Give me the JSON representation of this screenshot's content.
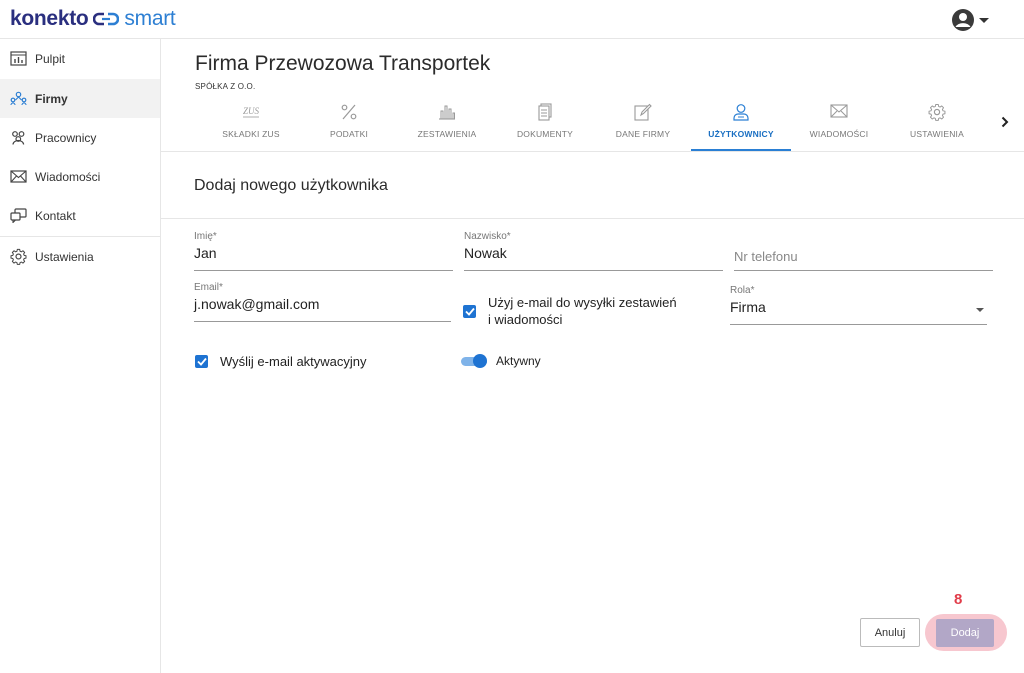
{
  "app": {
    "logo_left": "konekto",
    "logo_right": "smart"
  },
  "sidebar": {
    "items": [
      {
        "label": "Pulpit",
        "icon": "dashboard-icon"
      },
      {
        "label": "Firmy",
        "icon": "companies-icon"
      },
      {
        "label": "Pracownicy",
        "icon": "employees-icon"
      },
      {
        "label": "Wiadomości",
        "icon": "envelope-icon"
      },
      {
        "label": "Kontakt",
        "icon": "contact-icon"
      },
      {
        "label": "Ustawienia",
        "icon": "gear-icon"
      }
    ],
    "active": "Firmy"
  },
  "header": {
    "company_name": "Firma Przewozowa Transportek",
    "company_type": "SPÓŁKA Z O.O."
  },
  "tabs": [
    {
      "label": "SKŁADKI ZUS",
      "icon": "zus-icon"
    },
    {
      "label": "PODATKI",
      "icon": "percent-icon"
    },
    {
      "label": "ZESTAWIENIA",
      "icon": "bar-chart-icon"
    },
    {
      "label": "DOKUMENTY",
      "icon": "document-icon"
    },
    {
      "label": "DANE FIRMY",
      "icon": "edit-icon"
    },
    {
      "label": "UŻYTKOWNICY",
      "icon": "user-icon"
    },
    {
      "label": "WIADOMOŚCI",
      "icon": "envelope-icon"
    },
    {
      "label": "USTAWIENIA",
      "icon": "gear-icon"
    }
  ],
  "active_tab": "UŻYTKOWNICY",
  "zus_icon_text": "ZUS",
  "form": {
    "title": "Dodaj nowego użytkownika",
    "first_name": {
      "label": "Imię*",
      "value": "Jan"
    },
    "last_name": {
      "label": "Nazwisko*",
      "value": "Nowak"
    },
    "phone": {
      "placeholder": "Nr telefonu",
      "value": ""
    },
    "email": {
      "label": "Email*",
      "value": "j.nowak@gmail.com"
    },
    "use_email": {
      "label_line1": "Użyj e-mail do wysyłki zestawień",
      "label_line2": "i wiadomości",
      "checked": true
    },
    "role": {
      "label": "Rola*",
      "value": "Firma"
    },
    "send_activation": {
      "label": "Wyślij e-mail aktywacyjny",
      "checked": true
    },
    "active": {
      "label": "Aktywny",
      "on": true
    }
  },
  "actions": {
    "cancel_label": "Anuluj",
    "add_label": "Dodaj",
    "step_marker": "8"
  },
  "colors": {
    "brand_dark": "#2a2f7f",
    "brand_blue": "#2d7fd3",
    "accent": "#1e73d2",
    "highlight": "#f7c7cf",
    "step_marker": "#e13d4a"
  }
}
